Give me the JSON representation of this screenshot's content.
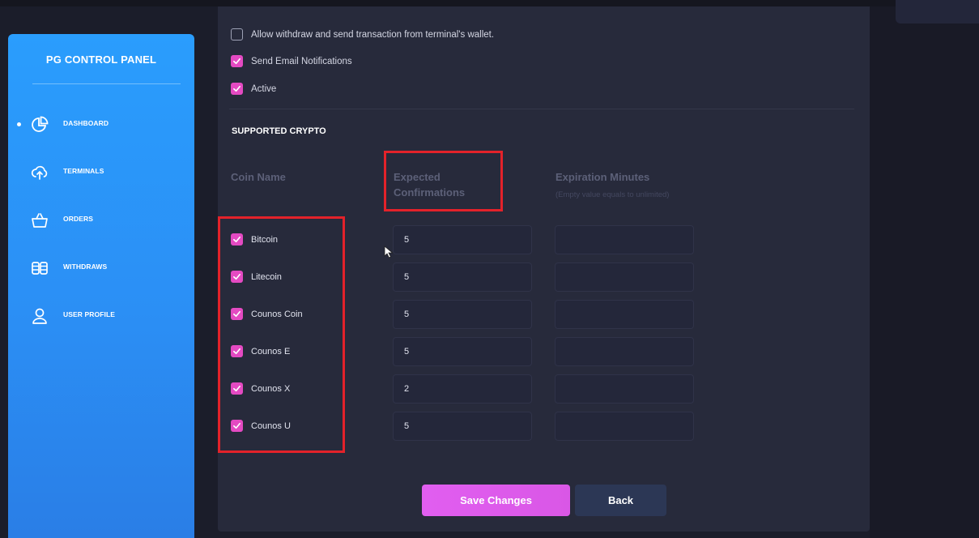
{
  "sidebar": {
    "title": "PG CONTROL PANEL",
    "items": [
      {
        "label": "DASHBOARD",
        "icon": "pie-chart-icon"
      },
      {
        "label": "TERMINALS",
        "icon": "cloud-upload-icon"
      },
      {
        "label": "ORDERS",
        "icon": "shopping-basket-icon"
      },
      {
        "label": "WITHDRAWS",
        "icon": "coins-stack-icon"
      },
      {
        "label": "USER PROFILE",
        "icon": "user-icon"
      }
    ]
  },
  "settings": {
    "allow_withdraw": {
      "label": "Allow withdraw and send transaction from terminal's wallet.",
      "checked": false
    },
    "email_notifications": {
      "label": "Send Email Notifications",
      "checked": true
    },
    "active": {
      "label": "Active",
      "checked": true
    }
  },
  "crypto": {
    "section_title": "SUPPORTED CRYPTO",
    "col_coin": "Coin Name",
    "col_confirm_line1": "Expected",
    "col_confirm_line2": "Confirmations",
    "col_expire": "Expiration Minutes",
    "col_expire_sub": "(Empty value equals to unlimited)",
    "coins": [
      {
        "name": "Bitcoin",
        "checked": true,
        "confirmations": "5",
        "expiration": ""
      },
      {
        "name": "Litecoin",
        "checked": true,
        "confirmations": "5",
        "expiration": ""
      },
      {
        "name": "Counos Coin",
        "checked": true,
        "confirmations": "5",
        "expiration": ""
      },
      {
        "name": "Counos E",
        "checked": true,
        "confirmations": "5",
        "expiration": ""
      },
      {
        "name": "Counos X",
        "checked": true,
        "confirmations": "2",
        "expiration": ""
      },
      {
        "name": "Counos U",
        "checked": true,
        "confirmations": "5",
        "expiration": ""
      }
    ]
  },
  "actions": {
    "save": "Save Changes",
    "back": "Back"
  },
  "colors": {
    "accent": "#e44ac2",
    "sidebar": "#2a9dfd",
    "highlight": "#e3222a",
    "panel": "#272a3b"
  }
}
